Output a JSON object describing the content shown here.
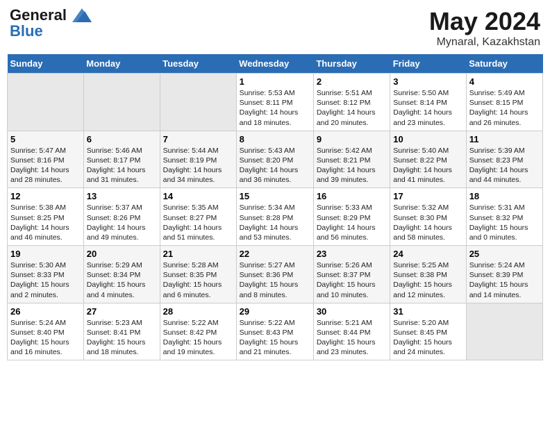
{
  "header": {
    "logo_line1": "General",
    "logo_line2": "Blue",
    "month_title": "May 2024",
    "location": "Mynaral, Kazakhstan"
  },
  "weekdays": [
    "Sunday",
    "Monday",
    "Tuesday",
    "Wednesday",
    "Thursday",
    "Friday",
    "Saturday"
  ],
  "weeks": [
    [
      {
        "day": "",
        "info": ""
      },
      {
        "day": "",
        "info": ""
      },
      {
        "day": "",
        "info": ""
      },
      {
        "day": "1",
        "info": "Sunrise: 5:53 AM\nSunset: 8:11 PM\nDaylight: 14 hours\nand 18 minutes."
      },
      {
        "day": "2",
        "info": "Sunrise: 5:51 AM\nSunset: 8:12 PM\nDaylight: 14 hours\nand 20 minutes."
      },
      {
        "day": "3",
        "info": "Sunrise: 5:50 AM\nSunset: 8:14 PM\nDaylight: 14 hours\nand 23 minutes."
      },
      {
        "day": "4",
        "info": "Sunrise: 5:49 AM\nSunset: 8:15 PM\nDaylight: 14 hours\nand 26 minutes."
      }
    ],
    [
      {
        "day": "5",
        "info": "Sunrise: 5:47 AM\nSunset: 8:16 PM\nDaylight: 14 hours\nand 28 minutes."
      },
      {
        "day": "6",
        "info": "Sunrise: 5:46 AM\nSunset: 8:17 PM\nDaylight: 14 hours\nand 31 minutes."
      },
      {
        "day": "7",
        "info": "Sunrise: 5:44 AM\nSunset: 8:19 PM\nDaylight: 14 hours\nand 34 minutes."
      },
      {
        "day": "8",
        "info": "Sunrise: 5:43 AM\nSunset: 8:20 PM\nDaylight: 14 hours\nand 36 minutes."
      },
      {
        "day": "9",
        "info": "Sunrise: 5:42 AM\nSunset: 8:21 PM\nDaylight: 14 hours\nand 39 minutes."
      },
      {
        "day": "10",
        "info": "Sunrise: 5:40 AM\nSunset: 8:22 PM\nDaylight: 14 hours\nand 41 minutes."
      },
      {
        "day": "11",
        "info": "Sunrise: 5:39 AM\nSunset: 8:23 PM\nDaylight: 14 hours\nand 44 minutes."
      }
    ],
    [
      {
        "day": "12",
        "info": "Sunrise: 5:38 AM\nSunset: 8:25 PM\nDaylight: 14 hours\nand 46 minutes."
      },
      {
        "day": "13",
        "info": "Sunrise: 5:37 AM\nSunset: 8:26 PM\nDaylight: 14 hours\nand 49 minutes."
      },
      {
        "day": "14",
        "info": "Sunrise: 5:35 AM\nSunset: 8:27 PM\nDaylight: 14 hours\nand 51 minutes."
      },
      {
        "day": "15",
        "info": "Sunrise: 5:34 AM\nSunset: 8:28 PM\nDaylight: 14 hours\nand 53 minutes."
      },
      {
        "day": "16",
        "info": "Sunrise: 5:33 AM\nSunset: 8:29 PM\nDaylight: 14 hours\nand 56 minutes."
      },
      {
        "day": "17",
        "info": "Sunrise: 5:32 AM\nSunset: 8:30 PM\nDaylight: 14 hours\nand 58 minutes."
      },
      {
        "day": "18",
        "info": "Sunrise: 5:31 AM\nSunset: 8:32 PM\nDaylight: 15 hours\nand 0 minutes."
      }
    ],
    [
      {
        "day": "19",
        "info": "Sunrise: 5:30 AM\nSunset: 8:33 PM\nDaylight: 15 hours\nand 2 minutes."
      },
      {
        "day": "20",
        "info": "Sunrise: 5:29 AM\nSunset: 8:34 PM\nDaylight: 15 hours\nand 4 minutes."
      },
      {
        "day": "21",
        "info": "Sunrise: 5:28 AM\nSunset: 8:35 PM\nDaylight: 15 hours\nand 6 minutes."
      },
      {
        "day": "22",
        "info": "Sunrise: 5:27 AM\nSunset: 8:36 PM\nDaylight: 15 hours\nand 8 minutes."
      },
      {
        "day": "23",
        "info": "Sunrise: 5:26 AM\nSunset: 8:37 PM\nDaylight: 15 hours\nand 10 minutes."
      },
      {
        "day": "24",
        "info": "Sunrise: 5:25 AM\nSunset: 8:38 PM\nDaylight: 15 hours\nand 12 minutes."
      },
      {
        "day": "25",
        "info": "Sunrise: 5:24 AM\nSunset: 8:39 PM\nDaylight: 15 hours\nand 14 minutes."
      }
    ],
    [
      {
        "day": "26",
        "info": "Sunrise: 5:24 AM\nSunset: 8:40 PM\nDaylight: 15 hours\nand 16 minutes."
      },
      {
        "day": "27",
        "info": "Sunrise: 5:23 AM\nSunset: 8:41 PM\nDaylight: 15 hours\nand 18 minutes."
      },
      {
        "day": "28",
        "info": "Sunrise: 5:22 AM\nSunset: 8:42 PM\nDaylight: 15 hours\nand 19 minutes."
      },
      {
        "day": "29",
        "info": "Sunrise: 5:22 AM\nSunset: 8:43 PM\nDaylight: 15 hours\nand 21 minutes."
      },
      {
        "day": "30",
        "info": "Sunrise: 5:21 AM\nSunset: 8:44 PM\nDaylight: 15 hours\nand 23 minutes."
      },
      {
        "day": "31",
        "info": "Sunrise: 5:20 AM\nSunset: 8:45 PM\nDaylight: 15 hours\nand 24 minutes."
      },
      {
        "day": "",
        "info": ""
      }
    ]
  ]
}
